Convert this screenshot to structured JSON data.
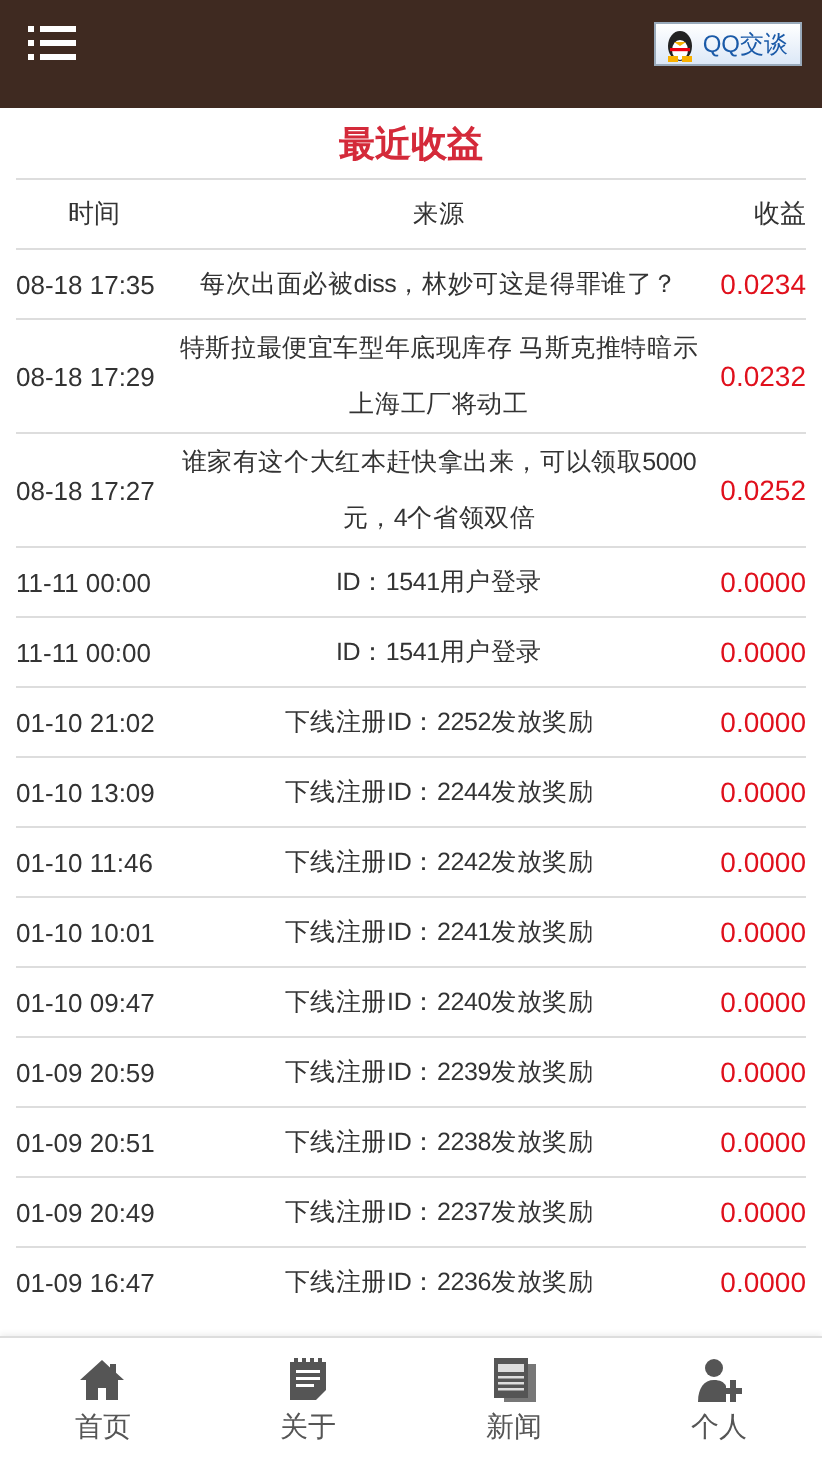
{
  "header": {
    "qq_button": "QQ交谈"
  },
  "title": "最近收益",
  "table": {
    "columns": [
      "时间",
      "来源",
      "收益"
    ],
    "rows": [
      {
        "time": "08-18 17:35",
        "source": "每次出面必被diss，林妙可这是得罪谁了？",
        "income": "0.0234"
      },
      {
        "time": "08-18 17:29",
        "source": "特斯拉最便宜车型年底现库存 马斯克推特暗示上海工厂将动工",
        "income": "0.0232"
      },
      {
        "time": "08-18 17:27",
        "source": "谁家有这个大红本赶快拿出来，可以领取5000元，4个省领双倍",
        "income": "0.0252"
      },
      {
        "time": "11-11 00:00",
        "source": "ID：1541用户登录",
        "income": "0.0000"
      },
      {
        "time": "11-11 00:00",
        "source": "ID：1541用户登录",
        "income": "0.0000"
      },
      {
        "time": "01-10 21:02",
        "source": "下线注册ID：2252发放奖励",
        "income": "0.0000"
      },
      {
        "time": "01-10 13:09",
        "source": "下线注册ID：2244发放奖励",
        "income": "0.0000"
      },
      {
        "time": "01-10 11:46",
        "source": "下线注册ID：2242发放奖励",
        "income": "0.0000"
      },
      {
        "time": "01-10 10:01",
        "source": "下线注册ID：2241发放奖励",
        "income": "0.0000"
      },
      {
        "time": "01-10 09:47",
        "source": "下线注册ID：2240发放奖励",
        "income": "0.0000"
      },
      {
        "time": "01-09 20:59",
        "source": "下线注册ID：2239发放奖励",
        "income": "0.0000"
      },
      {
        "time": "01-09 20:51",
        "source": "下线注册ID：2238发放奖励",
        "income": "0.0000"
      },
      {
        "time": "01-09 20:49",
        "source": "下线注册ID：2237发放奖励",
        "income": "0.0000"
      },
      {
        "time": "01-09 16:47",
        "source": "下线注册ID：2236发放奖励",
        "income": "0.0000"
      }
    ]
  },
  "nav": [
    {
      "kind": "home",
      "label": "首页"
    },
    {
      "kind": "about",
      "label": "关于"
    },
    {
      "kind": "news",
      "label": "新闻"
    },
    {
      "kind": "person",
      "label": "个人"
    }
  ]
}
